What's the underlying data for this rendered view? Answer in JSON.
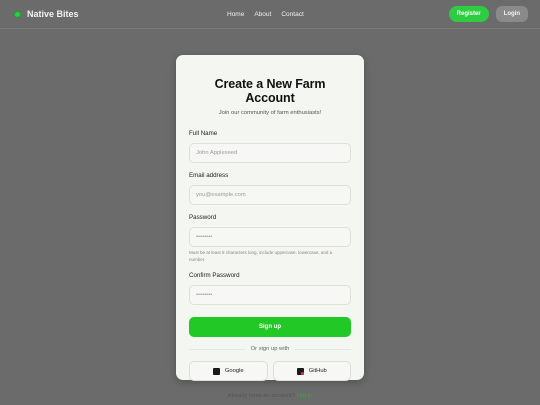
{
  "header": {
    "brand": "Native Bites",
    "nav": [
      "Home",
      "About",
      "Contact"
    ],
    "register_label": "Register",
    "login_label": "Login"
  },
  "card": {
    "title": "Create a New Farm Account",
    "subtitle": "Join our community of farm enthusiasts!",
    "full_name": {
      "label": "Full Name",
      "placeholder": "John Appleseed"
    },
    "email": {
      "label": "Email address",
      "placeholder": "you@example.com"
    },
    "password": {
      "label": "Password",
      "placeholder": "••••••••",
      "helper": "Must be at least 8 characters long, include uppercase, lowercase, and a number."
    },
    "confirm": {
      "label": "Confirm Password",
      "placeholder": "••••••••"
    },
    "signup_label": "Sign up",
    "divider": "Or sign up with",
    "google_label": "Google",
    "github_label": "GitHub",
    "footer_prefix": "Already have an account?",
    "footer_link": "Log in"
  },
  "colors": {
    "accent": "#22c825",
    "background": "#6b6b6b",
    "card": "#f4f6f2"
  }
}
